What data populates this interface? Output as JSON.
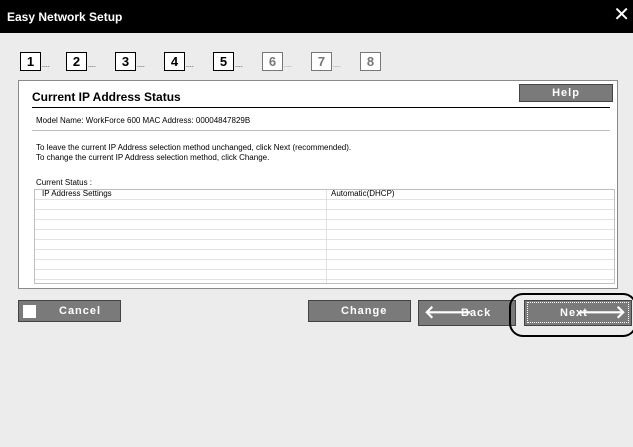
{
  "window": {
    "title": "Easy Network Setup",
    "close_glyph": "✕"
  },
  "steps": [
    {
      "number": "1",
      "dots": "....",
      "active": true
    },
    {
      "number": "2",
      "dots": "....",
      "active": true
    },
    {
      "number": "3",
      "dots": "....",
      "active": true
    },
    {
      "number": "4",
      "dots": "....",
      "active": true
    },
    {
      "number": "5",
      "dots": "....",
      "active": true
    },
    {
      "number": "6",
      "dots": "....",
      "active": false
    },
    {
      "number": "7",
      "dots": "....",
      "active": false
    },
    {
      "number": "8",
      "dots": "",
      "active": false
    }
  ],
  "panel": {
    "title": "Current IP Address Status",
    "help_label": "Help",
    "model_line": "Model Name: WorkForce 600    MAC Address: 00004847829B",
    "instructions": [
      "To leave the current IP Address selection method unchanged, click Next (recommended).",
      "To change the current IP Address selection method, click Change."
    ],
    "status_label": "Current Status :",
    "status_rows": [
      {
        "setting": "IP Address Settings",
        "value": "Automatic(DHCP)"
      }
    ]
  },
  "buttons": {
    "cancel": "Cancel",
    "change": "Change",
    "back": "Back",
    "next": "Next",
    "back_arrow": "🡐",
    "next_arrow": "🡒"
  },
  "colors": {
    "titlebar": "#000000",
    "button_bg": "#7a7a7a",
    "window_bg": "#ececec",
    "panel_bg": "#ffffff"
  }
}
